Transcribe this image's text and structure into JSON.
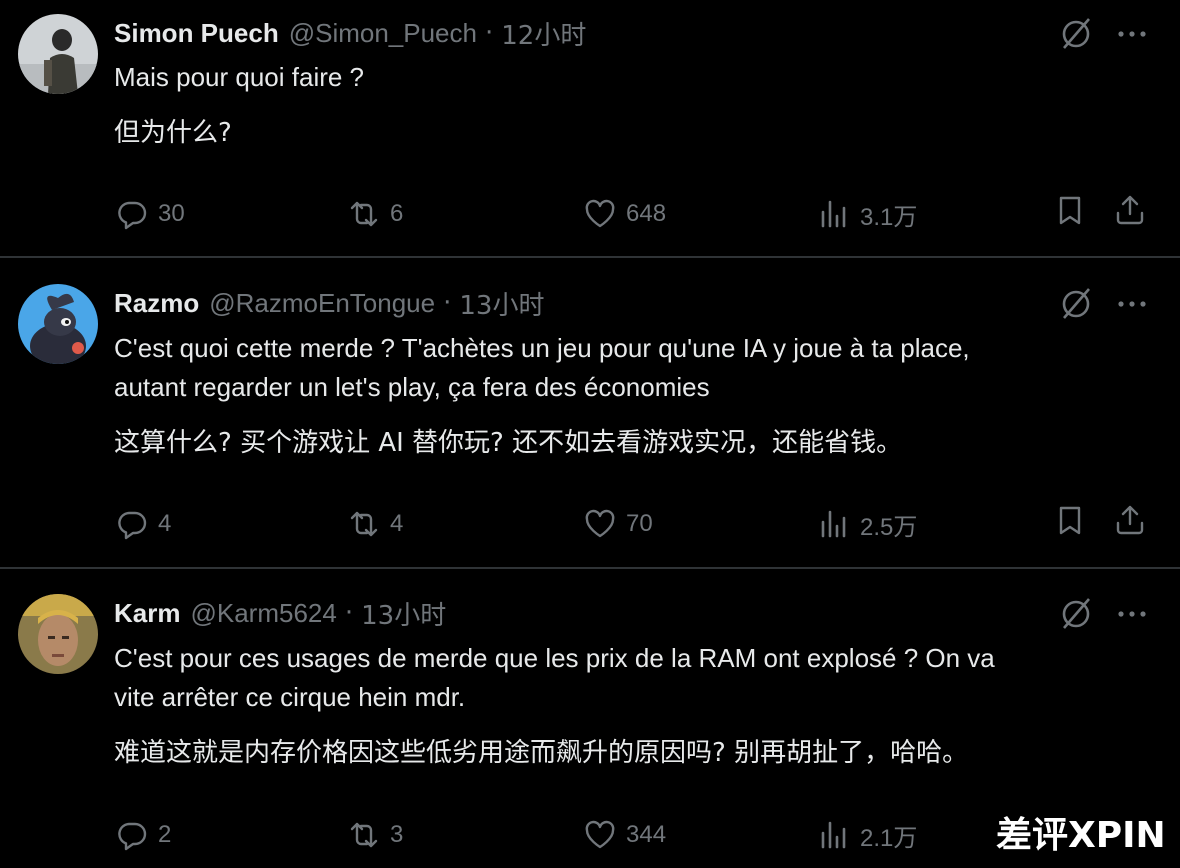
{
  "tweets": [
    {
      "name": "Simon Puech",
      "handle": "@Simon_Puech",
      "time": "12小时",
      "text_fr": "Mais pour quoi faire ?",
      "text_fr2": "",
      "text_zh": "但为什么?",
      "replies": "30",
      "retweets": "6",
      "likes": "648",
      "views": "3.1万",
      "avatar_icon": "avatar-person-icon"
    },
    {
      "name": "Razmo",
      "handle": "@RazmoEnTongue",
      "time": "13小时",
      "text_fr": "C'est quoi cette merde ? T'achètes un jeu pour qu'une IA y joue à ta place,",
      "text_fr2": "autant regarder un let's play, ça fera des économies",
      "text_zh": "这算什么? 买个游戏让 AI 替你玩? 还不如去看游戏实况，还能省钱。",
      "replies": "4",
      "retweets": "4",
      "likes": "70",
      "views": "2.5万",
      "avatar_icon": "avatar-cartoon-icon"
    },
    {
      "name": "Karm",
      "handle": "@Karm5624",
      "time": "13小时",
      "text_fr": "C'est pour ces usages de merde que les prix de la RAM ont explosé ? On va",
      "text_fr2": "vite arrêter ce cirque hein mdr.",
      "text_zh": "难道这就是内存价格因这些低劣用途而飙升的原因吗? 别再胡扯了，哈哈。",
      "replies": "2",
      "retweets": "3",
      "likes": "344",
      "views": "2.1万",
      "avatar_icon": "avatar-face-icon"
    }
  ],
  "watermark": "差评XPIN",
  "colors": {
    "background": "#000000",
    "text": "#e7e9ea",
    "muted": "#71767b",
    "divider": "#2f3336"
  }
}
